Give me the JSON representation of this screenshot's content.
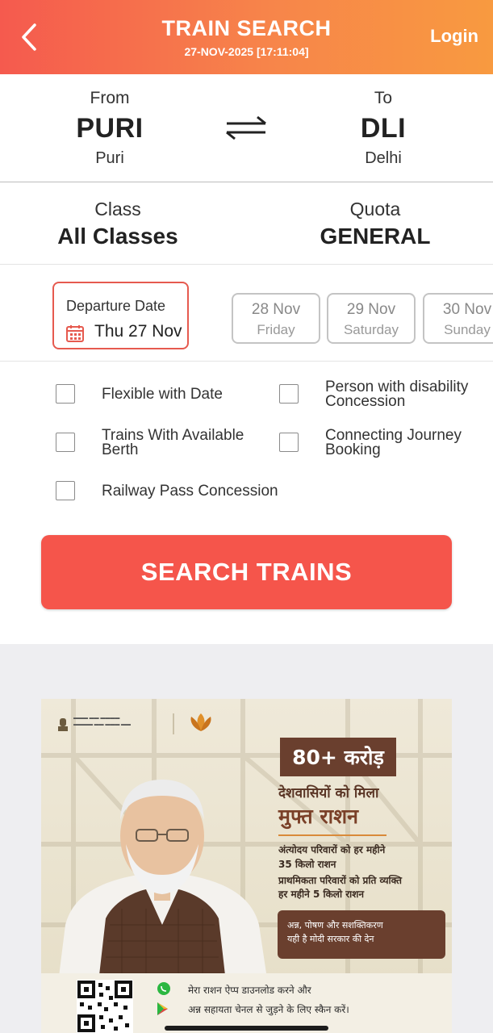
{
  "header": {
    "title": "TRAIN SEARCH",
    "subtitle": "27-NOV-2025 [17:11:04]",
    "login_label": "Login",
    "back_icon": "chevron-left-icon",
    "gradient_colors": [
      "#f55a4e",
      "#f89a40"
    ]
  },
  "route": {
    "from": {
      "label": "From",
      "code": "PURI",
      "name": "Puri"
    },
    "to": {
      "label": "To",
      "code": "DLI",
      "name": "Delhi"
    },
    "swap_icon": "swap-arrows-icon"
  },
  "class_quota": {
    "class": {
      "label": "Class",
      "value": "All Classes"
    },
    "quota": {
      "label": "Quota",
      "value": "GENERAL"
    }
  },
  "dates": {
    "departure": {
      "label": "Departure Date",
      "value": "Thu 27 Nov",
      "icon": "calendar-icon"
    },
    "chips": [
      {
        "date": "28 Nov",
        "day": "Friday"
      },
      {
        "date": "29 Nov",
        "day": "Saturday"
      },
      {
        "date": "30 Nov",
        "day": "Sunday"
      }
    ]
  },
  "options": {
    "flexible_date": "Flexible with Date",
    "pwd_line1": "Person with disability",
    "pwd_line2": "Concession",
    "available_berth_line1": "Trains With Available",
    "available_berth_line2": "Berth",
    "connecting_line1": "Connecting Journey",
    "connecting_line2": "Booking",
    "railway_pass": "Railway Pass Concession"
  },
  "search_button": {
    "label": "SEARCH TRAINS",
    "color": "#f5554b"
  },
  "ad": {
    "badge": "80+ करोड़",
    "headline1": "देशवासियों को मिला",
    "headline2": "मुफ्त राशन",
    "line1": "अंत्योदय परिवारों को हर महीने",
    "line2": "35 किलो राशन",
    "line3": "प्राथमिकता परिवारों को प्रति व्यक्ति",
    "line4": "हर महीने 5 किलो राशन",
    "tag_line1": "अन्न, पोषण और सशक्तिकरण",
    "tag_line2": "यही है मोदी सरकार की देन",
    "qr_line1": "मेरा राशन ऐप्प डाउनलोड करने और",
    "qr_line2": "अन्न सहायता चेनल से जुड़ने के लिए स्कैन करें।"
  },
  "accent_colors": {
    "header": "#f7854a",
    "selected_border": "#e65a4f",
    "ad_brown": "#6a3f2e"
  }
}
